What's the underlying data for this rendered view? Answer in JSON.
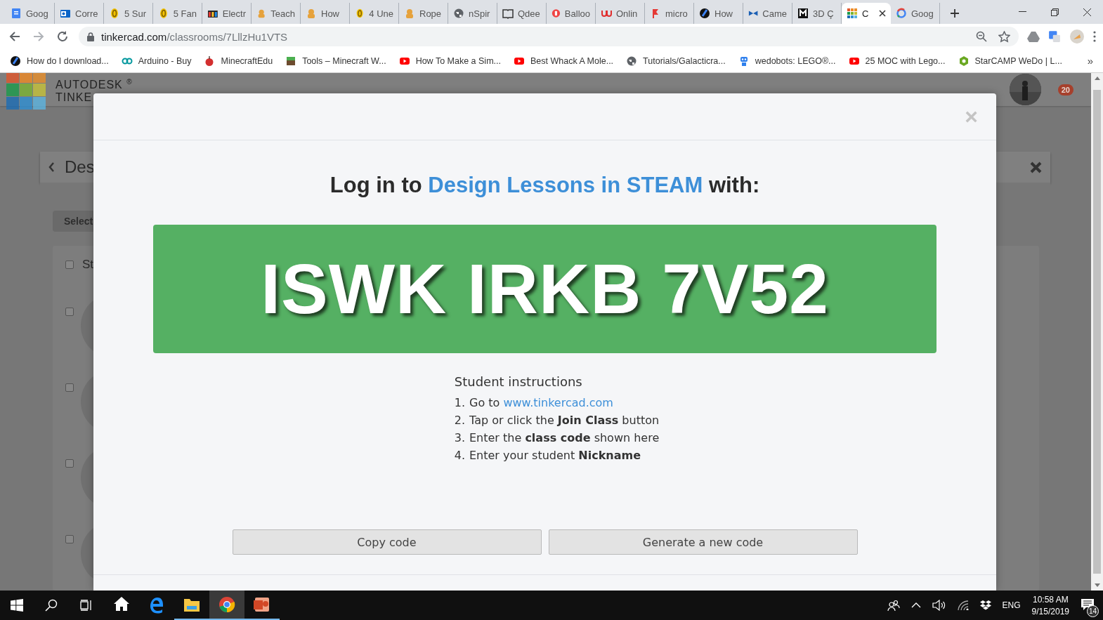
{
  "browser": {
    "tabs": [
      {
        "kind": "docs",
        "title": "Goog",
        "selected": false
      },
      {
        "kind": "mail",
        "title": "Corre",
        "selected": false
      },
      {
        "kind": "coin",
        "title": "5 Sur",
        "selected": false
      },
      {
        "kind": "coin",
        "title": "5 Fan",
        "selected": false
      },
      {
        "kind": "stripes",
        "title": "Electr",
        "selected": false
      },
      {
        "kind": "figure",
        "title": "Teach",
        "selected": false
      },
      {
        "kind": "figure",
        "title": "How",
        "selected": false
      },
      {
        "kind": "coin",
        "title": "4 Une",
        "selected": false
      },
      {
        "kind": "figure",
        "title": "Rope",
        "selected": false
      },
      {
        "kind": "globe",
        "title": "nSpir",
        "selected": false
      },
      {
        "kind": "book",
        "title": "Qdee",
        "selected": false
      },
      {
        "kind": "redcircle",
        "title": "Balloo",
        "selected": false
      },
      {
        "kind": "wave",
        "title": "Onlin",
        "selected": false
      },
      {
        "kind": "flag",
        "title": "micro",
        "selected": false
      },
      {
        "kind": "swirl",
        "title": "How",
        "selected": false
      },
      {
        "kind": "bow",
        "title": "Came",
        "selected": false
      },
      {
        "kind": "msquare",
        "title": "3D Ç",
        "selected": false
      },
      {
        "kind": "grid",
        "title": "C",
        "selected": true
      },
      {
        "kind": "gletter",
        "title": "Goog",
        "selected": false
      }
    ],
    "url_domain": "tinkercad.com",
    "url_path": "/classrooms/7LllzHu1VTS",
    "bookmarks": [
      {
        "kind": "swirl",
        "title": "How do I download..."
      },
      {
        "kind": "infinity",
        "title": "Arduino - Buy"
      },
      {
        "kind": "apple",
        "title": "MinecraftEdu"
      },
      {
        "kind": "block",
        "title": "Tools – Minecraft W..."
      },
      {
        "kind": "play",
        "title": "How To Make a Sim..."
      },
      {
        "kind": "play",
        "title": "Best Whack A Mole..."
      },
      {
        "kind": "globe",
        "title": "Tutorials/Galacticra..."
      },
      {
        "kind": "robot",
        "title": "wedobots: LEGO®..."
      },
      {
        "kind": "play",
        "title": "25 MOC with Lego..."
      },
      {
        "kind": "hexagon",
        "title": "StarCAMP WeDo | L..."
      }
    ],
    "more": "»"
  },
  "page": {
    "brand_top": "AUTODESK",
    "brand_mark": "®",
    "brand_bottom": "TINKE",
    "notification_count": "20",
    "panel_title": "Des",
    "select_button": "Select",
    "header_row": {
      "label": "St",
      "checked": false
    },
    "rows": [
      {
        "checked": false
      },
      {
        "checked": false
      },
      {
        "checked": false
      },
      {
        "checked": false
      }
    ]
  },
  "modal": {
    "close": "×",
    "title_before": "Log in to",
    "title_link": "Design Lessons in STEAM",
    "title_after": "with:",
    "code": "ISWK IRKB 7V52",
    "instructions_title": "Student instructions",
    "steps": [
      {
        "number": "1.",
        "text": "Go to",
        "link": "www.tinkercad.com"
      },
      {
        "number": "2.",
        "text": "Tap or click the **Join Class** button"
      },
      {
        "number": "3.",
        "text": "Enter the **class code** shown here"
      },
      {
        "number": "4.",
        "text": "Enter your student **Nickname**"
      }
    ],
    "buttons": [
      "Copy code",
      "Generate a new code"
    ]
  },
  "taskbar": {
    "apps": [
      {
        "kind": "home",
        "running": false,
        "active": false
      },
      {
        "kind": "edge",
        "running": false,
        "active": false
      },
      {
        "kind": "folder",
        "running": true,
        "active": false
      },
      {
        "kind": "chrome",
        "running": true,
        "active": true
      },
      {
        "kind": "slides",
        "running": true,
        "active": false
      }
    ],
    "language": "ENG",
    "time": "10:58 AM",
    "date": "9/15/2019",
    "notifications": "14"
  }
}
